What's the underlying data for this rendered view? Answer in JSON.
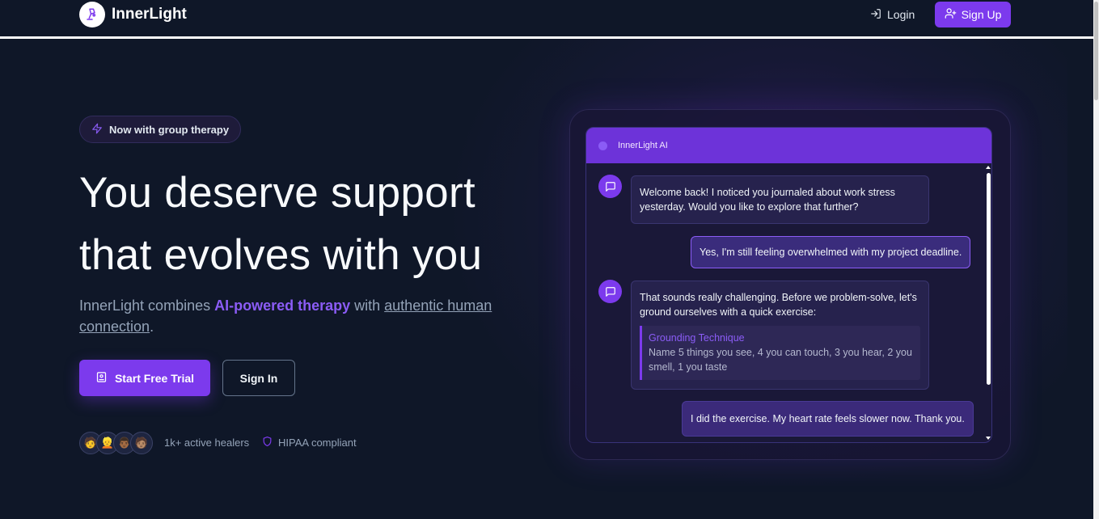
{
  "app": {
    "name": "InnerLight"
  },
  "nav": {
    "login_label": "Login",
    "signup_label": "Sign Up"
  },
  "hero": {
    "badge": "Now with group therapy",
    "headline_line1": "You deserve support",
    "headline_line2": "that evolves with you",
    "sub_prefix": "InnerLight combines ",
    "sub_accent": "AI-powered therapy",
    "sub_middle": " with ",
    "sub_link": "authentic human connection",
    "sub_suffix": ".",
    "primary_cta": "Start Free Trial",
    "secondary_cta": "Sign In",
    "avatars": [
      "🧑",
      "👱",
      "👨🏾",
      "🧑🏽"
    ],
    "healers_text": "1k+ active healers",
    "hipaa_text": "HIPAA compliant"
  },
  "chat": {
    "title": "InnerLight AI",
    "messages": [
      {
        "from": "ai",
        "text": "Welcome back! I noticed you journaled about work stress yesterday. Would you like to explore that further?"
      },
      {
        "from": "user",
        "text": "Yes, I'm still feeling overwhelmed with my project deadline."
      },
      {
        "from": "ai",
        "text": "That sounds really challenging. Before we problem-solve, let's ground ourselves with a quick exercise:",
        "technique_title": "Grounding Technique",
        "technique_body": "Name 5 things you see, 4 you can touch, 3 you hear, 2 you smell, 1 you taste"
      },
      {
        "from": "user",
        "text": "I did the exercise. My heart rate feels slower now. Thank you."
      }
    ]
  },
  "colors": {
    "accent": "#7c3aed",
    "background": "#0f1728",
    "accent_text": "#8b5cf6"
  },
  "icons": [
    "lamp-logo-icon",
    "login-icon",
    "user-plus-icon",
    "zap-icon",
    "journal-icon",
    "shield-icon",
    "message-icon"
  ]
}
